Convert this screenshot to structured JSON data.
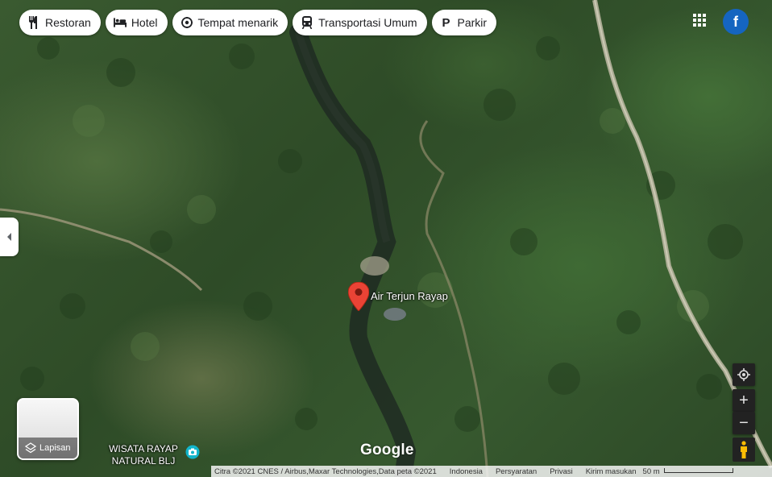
{
  "chips": [
    {
      "label": "Restoran",
      "icon": "restaurant-icon"
    },
    {
      "label": "Hotel",
      "icon": "hotel-icon"
    },
    {
      "label": "Tempat menarik",
      "icon": "attraction-icon"
    },
    {
      "label": "Transportasi Umum",
      "icon": "transit-icon"
    },
    {
      "label": "Parkir",
      "icon": "parking-icon"
    }
  ],
  "account": {
    "avatar_letter": "f",
    "apps_icon": "apps-grid-icon"
  },
  "place": {
    "name": "Air Terjun Rayap",
    "marker_color": "#ea4335"
  },
  "poi": {
    "line1": "WISATA RAYAP",
    "line2": "NATURAL BLJ",
    "icon_color": "#12b5cb"
  },
  "layers": {
    "label": "Lapisan"
  },
  "branding": {
    "logo": "Google"
  },
  "controls": {
    "zoom_in": "+",
    "zoom_out": "−"
  },
  "footer": {
    "attribution": "Citra ©2021 CNES / Airbus,Maxar Technologies,Data peta ©2021",
    "country": "Indonesia",
    "terms": "Persyaratan",
    "privacy": "Privasi",
    "feedback": "Kirim masukan",
    "scale": "50 m"
  }
}
